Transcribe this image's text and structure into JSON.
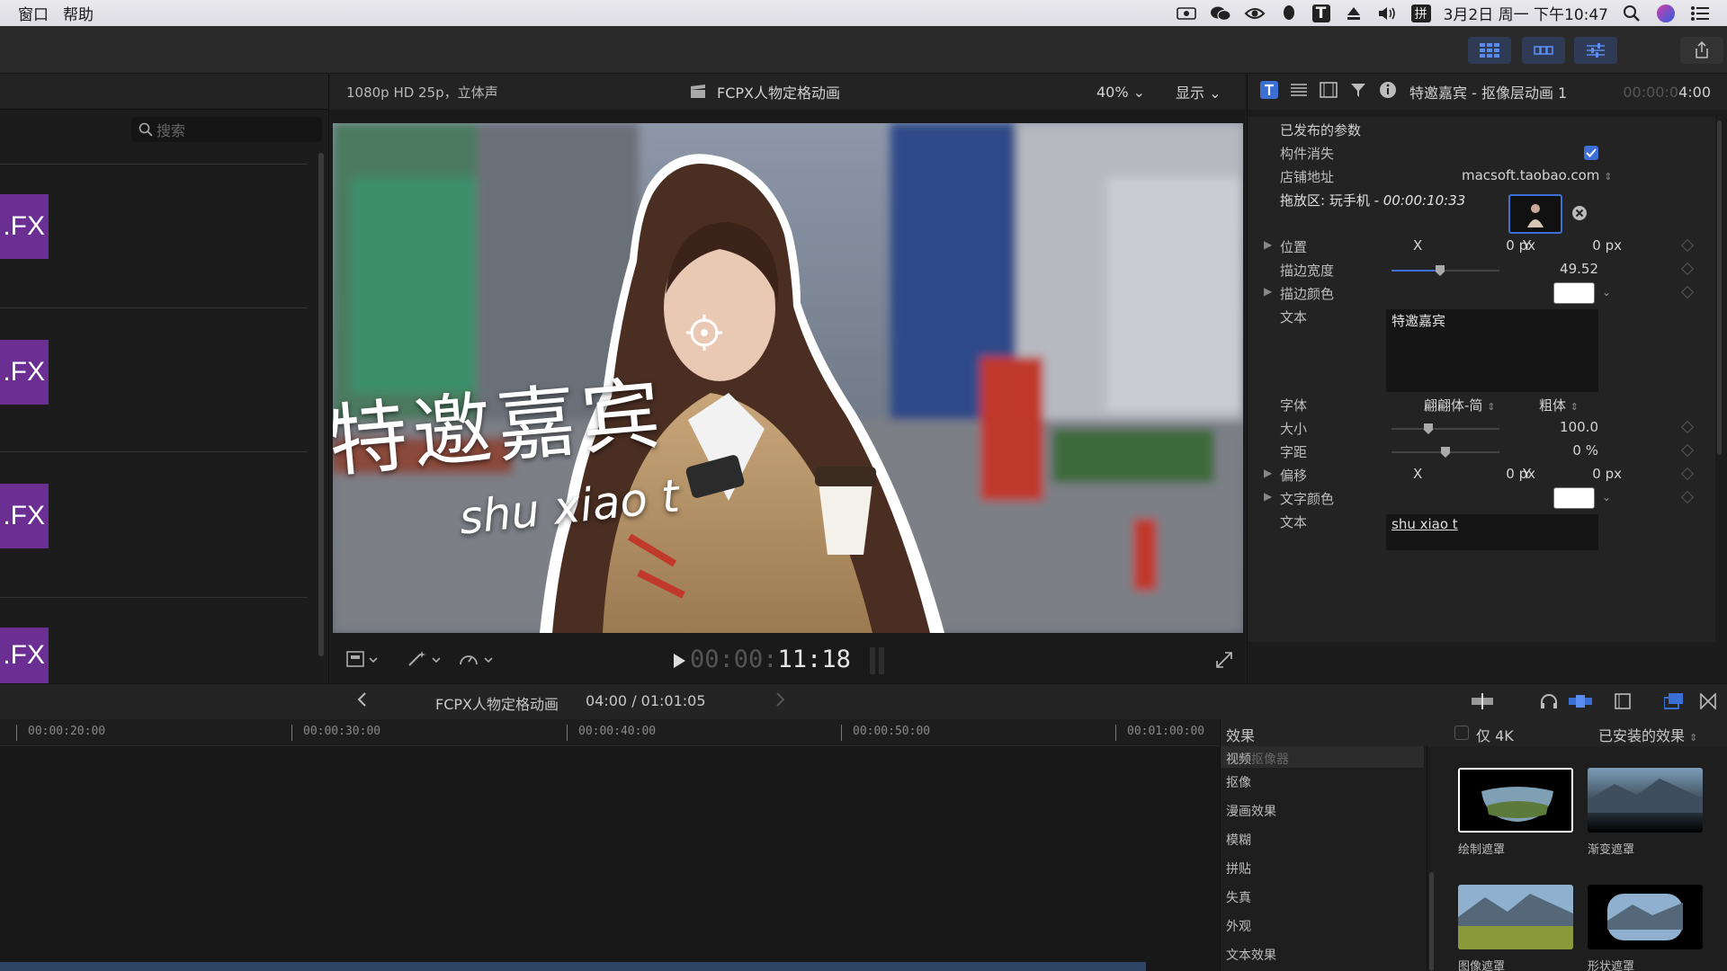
{
  "menubar": {
    "items": [
      "窗口",
      "帮助"
    ],
    "clock": "3月2日 周一 下午10:47",
    "ime": "拼",
    "text_icon": "T"
  },
  "browser": {
    "search_placeholder": "搜索",
    "clip_labels": [
      ".FX",
      ".FX",
      ".FX",
      ".FX"
    ]
  },
  "viewer": {
    "format": "1080p HD 25p，立体声",
    "project": "FCPX人物定格动画",
    "zoom": "40%",
    "display": "显示",
    "overlay_title": "特邀嘉宾",
    "overlay_sub": "shu xiao t",
    "timecode_dim": "00:00:",
    "timecode": "11:18"
  },
  "inspector": {
    "title": "特邀嘉宾 - 抠像层动画 1",
    "duration_dim": "00:00:0",
    "duration": "4:00",
    "section": "已发布的参数",
    "params": {
      "fade_label": "构件消失",
      "store_label": "店铺地址",
      "store_value": "macsoft.taobao.com",
      "drop_label": "拖放区: 玩手机",
      "drop_time": "- 00:00:10:33",
      "position_label": "位置",
      "x_label": "X",
      "y_label": "Y",
      "position_x": "0 px",
      "position_y": "0 px",
      "stroke_width_label": "描边宽度",
      "stroke_width": "49.52",
      "stroke_width_fraction": 0.45,
      "stroke_color_label": "描边颜色",
      "text_label": "文本",
      "text_value": "特邀嘉宾",
      "font_label": "字体",
      "font_value": "翩翩体-简",
      "weight_value": "粗体",
      "size_label": "大小",
      "size_value": "100.0",
      "tracking_label": "字距",
      "tracking_value": "0 %",
      "offset_label": "偏移",
      "offset_x": "0 px",
      "offset_y": "0 px",
      "text_color_label": "文字颜色",
      "text2_label": "文本",
      "text2_value": "shu xiao t"
    }
  },
  "timeline": {
    "project": "FCPX人物定格动画",
    "position": "04:00 / 01:01:05",
    "ruler": [
      "00:00:20:00",
      "00:00:30:00",
      "00:00:40:00",
      "00:00:50:00",
      "00:01:00:00"
    ]
  },
  "effects": {
    "title": "效果",
    "only4k": "仅 4K",
    "installed": "已安装的效果",
    "categories": [
      "视频",
      "抠像",
      "漫画效果",
      "模糊",
      "拼贴",
      "失真",
      "外观",
      "文本效果"
    ],
    "selected_sub": "抠像器",
    "items": [
      "绘制遮罩",
      "渐变遮罩",
      "图像遮罩",
      "形状遮罩"
    ]
  },
  "colors": {
    "accent": "#3b6fd4",
    "clip_purple": "#6b2f93",
    "panel": "#232323"
  }
}
